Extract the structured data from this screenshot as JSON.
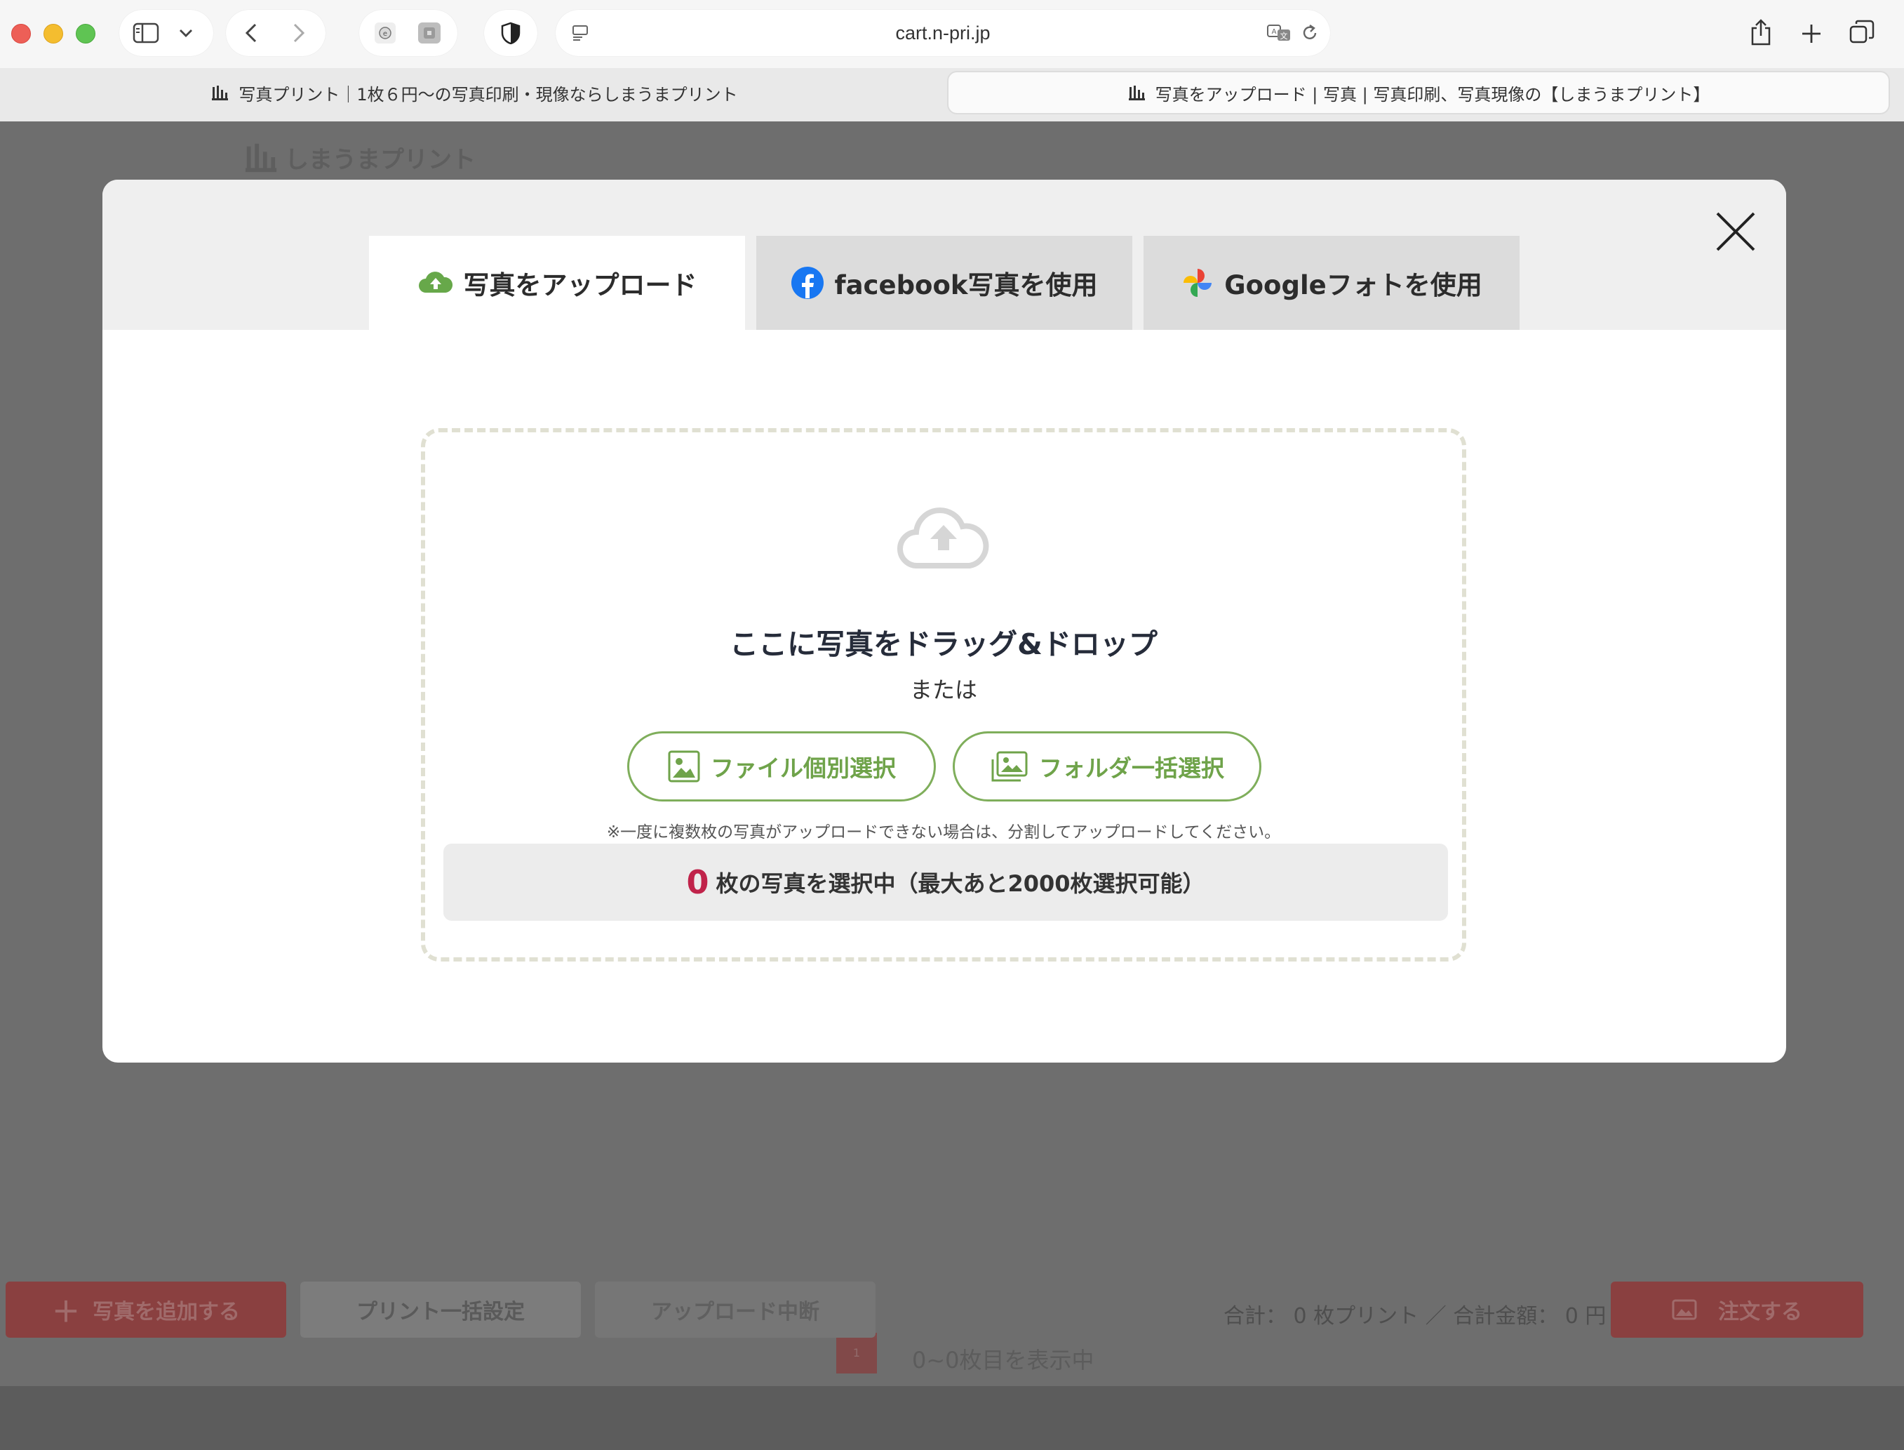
{
  "browser": {
    "url": "cart.n-pri.jp",
    "tabs": [
      {
        "title": "写真プリント｜1枚６円〜の写真印刷・現像ならしまうまプリント",
        "active": false
      },
      {
        "title": "写真をアップロード | 写真 | 写真印刷、写真現像の【しまうまプリント】",
        "active": true
      }
    ]
  },
  "background_page": {
    "logo_text": "しまうまプリント",
    "pager_label": "1",
    "count_text": "0~0枚目を表示中",
    "buttons": {
      "add": "写真を追加する",
      "bulk_print": "プリント一括設定",
      "stop_upload": "アップロード中断",
      "order": "注文する"
    },
    "total_text": "合計： 0 枚プリント ／ 合計金額： 0 円"
  },
  "modal": {
    "tabs": [
      {
        "label": "写真をアップロード",
        "icon": "cloud-upload-icon",
        "active": true
      },
      {
        "label": "facebook写真を使用",
        "icon": "facebook-icon",
        "active": false
      },
      {
        "label": "Googleフォトを使用",
        "icon": "google-photos-icon",
        "active": false
      }
    ],
    "dropzone": {
      "title": "ここに写真をドラッグ&ドロップ",
      "or_text": "または",
      "file_button": "ファイル個別選択",
      "folder_button": "フォルダ一括選択",
      "note": "※一度に複数枚の写真がアップロードできない場合は、分割してアップロードしてください。",
      "selected_count": "0",
      "selected_text": "枚の写真を選択中（最大あと2000枚選択可能）"
    }
  },
  "colors": {
    "accent_green": "#7fae5b",
    "count_red": "#c0234a",
    "overlay": "#6a6a6a"
  }
}
